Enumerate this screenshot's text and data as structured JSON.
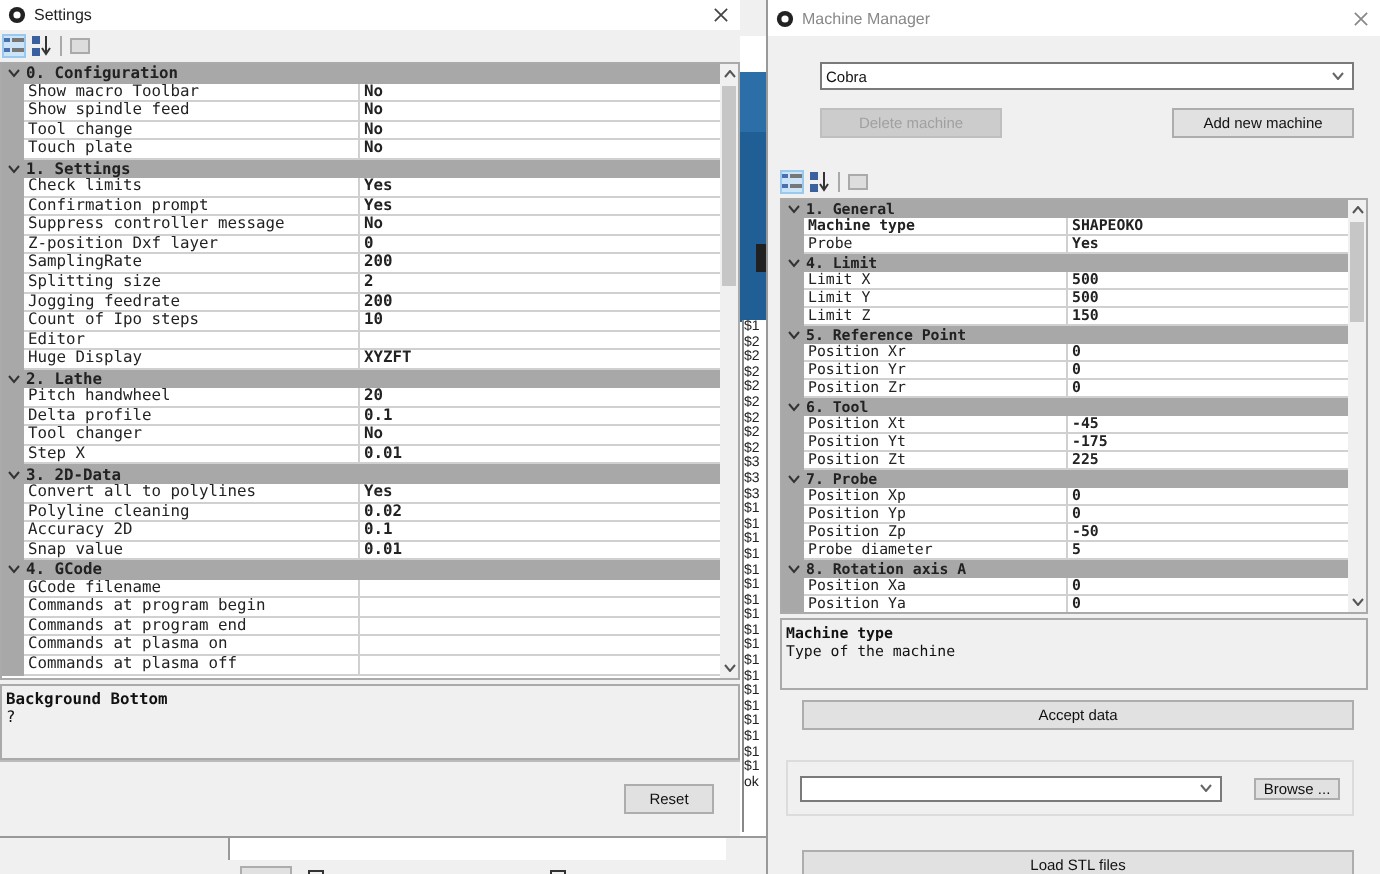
{
  "settings": {
    "title": "Settings",
    "toolbar": [
      {
        "kind": "categorized",
        "selected": true
      },
      {
        "kind": "alphabetical",
        "selected": false
      },
      {
        "kind": "pages",
        "selected": false
      }
    ],
    "categories": [
      {
        "name": "0. Configuration",
        "expanded": true,
        "items": [
          {
            "name": "Show macro Toolbar",
            "value": "No"
          },
          {
            "name": "Show spindle feed",
            "value": "No"
          },
          {
            "name": "Tool change",
            "value": "No"
          },
          {
            "name": "Touch plate",
            "value": "No"
          }
        ]
      },
      {
        "name": "1. Settings",
        "expanded": true,
        "items": [
          {
            "name": "Check limits",
            "value": "Yes"
          },
          {
            "name": "Confirmation prompt",
            "value": "Yes"
          },
          {
            "name": "Suppress controller message",
            "value": "No"
          },
          {
            "name": "Z-position Dxf layer",
            "value": "0"
          },
          {
            "name": "SamplingRate",
            "value": "200"
          },
          {
            "name": "Splitting size",
            "value": "2"
          },
          {
            "name": "Jogging feedrate",
            "value": "200"
          },
          {
            "name": "Count of Ipo steps",
            "value": "10"
          },
          {
            "name": "Editor"
          },
          {
            "name": "Huge Display",
            "value": "XYZFT"
          }
        ]
      },
      {
        "name": "2. Lathe",
        "expanded": true,
        "items": [
          {
            "name": "Pitch handwheel",
            "value": "20"
          },
          {
            "name": "Delta profile",
            "value": "0.1"
          },
          {
            "name": "Tool changer",
            "value": "No"
          },
          {
            "name": "Step X",
            "value": "0.01"
          }
        ]
      },
      {
        "name": "3. 2D-Data",
        "expanded": true,
        "items": [
          {
            "name": "Convert all to polylines",
            "value": "Yes"
          },
          {
            "name": "Polyline cleaning",
            "value": "0.02"
          },
          {
            "name": "Accuracy 2D",
            "value": "0.1"
          },
          {
            "name": "Snap value",
            "value": "0.01"
          }
        ]
      },
      {
        "name": "4. GCode",
        "expanded": true,
        "items": [
          {
            "name": "GCode filename"
          },
          {
            "name": "Commands at program begin"
          },
          {
            "name": "Commands at program end"
          },
          {
            "name": "Commands at plasma on"
          },
          {
            "name": "Commands at plasma off"
          }
        ]
      }
    ],
    "description": {
      "title": "Background Bottom",
      "text": "?"
    },
    "reset_button": "Reset"
  },
  "background_checkboxes": [
    {
      "checked": false
    },
    {
      "checked": false
    }
  ],
  "background_log": [
    "$1",
    "$2",
    "$2",
    "$2",
    "$2",
    "$2",
    "$2",
    "$2",
    "$2",
    "$3",
    "$3",
    "$3",
    "$1",
    "$1",
    "$1",
    "$1",
    "$1",
    "$1",
    "$1",
    "$1",
    "$1",
    "$1",
    "$1",
    "$1",
    "$1",
    "$1",
    "$1",
    "$1",
    "$1",
    "$1",
    "ok"
  ],
  "machine_manager": {
    "title": "Machine Manager",
    "machine": "Cobra",
    "delete_button": {
      "label": "Delete machine",
      "disabled": true
    },
    "add_button": {
      "label": "Add new machine",
      "disabled": false
    },
    "toolbar": [
      {
        "kind": "categorized",
        "selected": true
      },
      {
        "kind": "alphabetical",
        "selected": false
      },
      {
        "kind": "pages",
        "selected": false
      }
    ],
    "categories": [
      {
        "name": "1. General",
        "expanded": true,
        "items": [
          {
            "name": "Machine type",
            "value": "SHAPEOKO",
            "selected": true
          },
          {
            "name": "Probe",
            "value": "Yes",
            "selected": false
          }
        ]
      },
      {
        "name": "4. Limit",
        "expanded": true,
        "items": [
          {
            "name": "Limit X",
            "value": "500",
            "selected": false
          },
          {
            "name": "Limit Y",
            "value": "500",
            "selected": false
          },
          {
            "name": "Limit Z",
            "value": "150",
            "selected": false
          }
        ]
      },
      {
        "name": "5. Reference Point",
        "expanded": true,
        "items": [
          {
            "name": "Position Xr",
            "value": "0",
            "selected": false
          },
          {
            "name": "Position Yr",
            "value": "0",
            "selected": false
          },
          {
            "name": "Position Zr",
            "value": "0",
            "selected": false
          }
        ]
      },
      {
        "name": "6. Tool",
        "expanded": true,
        "items": [
          {
            "name": "Position Xt",
            "value": "-45",
            "selected": false
          },
          {
            "name": "Position Yt",
            "value": "-175",
            "selected": false
          },
          {
            "name": "Position Zt",
            "value": "225",
            "selected": false
          }
        ]
      },
      {
        "name": "7. Probe",
        "expanded": true,
        "items": [
          {
            "name": "Position Xp",
            "value": "0",
            "selected": false
          },
          {
            "name": "Position Yp",
            "value": "0",
            "selected": false
          },
          {
            "name": "Position Zp",
            "value": "-50",
            "selected": false
          },
          {
            "name": "Probe diameter",
            "value": "5",
            "selected": false
          }
        ]
      },
      {
        "name": "8. Rotation axis A",
        "expanded": true,
        "items": [
          {
            "name": "Position Xa",
            "value": "0",
            "selected": false
          },
          {
            "name": "Position Ya",
            "value": "0",
            "selected": false
          }
        ]
      }
    ],
    "description": {
      "title": "Machine type",
      "text": "Type of the machine"
    },
    "accept_button": "Accept data",
    "browse_button": "Browse ...",
    "load_button": "Load STL files"
  }
}
